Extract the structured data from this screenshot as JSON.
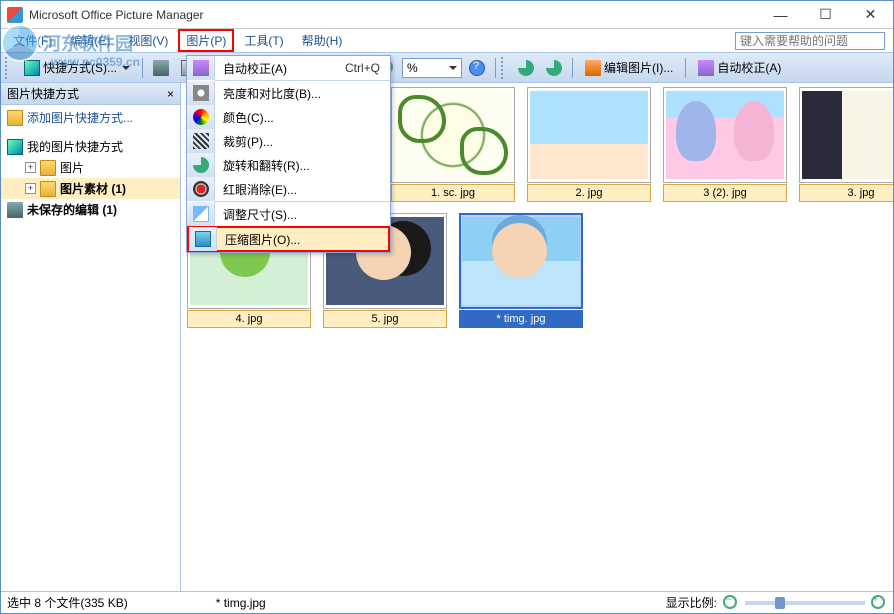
{
  "app": {
    "title": "Microsoft Office Picture Manager"
  },
  "window_controls": {
    "min": "—",
    "max": "☐",
    "close": "✕"
  },
  "menubar": {
    "items": [
      {
        "label": "文件(F)"
      },
      {
        "label": "编辑(E)"
      },
      {
        "label": "视图(V)"
      },
      {
        "label": "图片(P)",
        "active": true
      },
      {
        "label": "工具(T)"
      },
      {
        "label": "帮助(H)"
      }
    ],
    "help_placeholder": "键入需要帮助的问题"
  },
  "toolbar1": {
    "shortcut_label": "快捷方式(S)...",
    "zoom_value": "%"
  },
  "toolbar2": {
    "edit_btn": "编辑图片(I)...",
    "auto_btn": "自动校正(A)"
  },
  "dropdown": {
    "items": [
      {
        "label": "自动校正(A)",
        "accel": "Ctrl+Q",
        "icon": "auto"
      },
      {
        "label": "亮度和对比度(B)...",
        "icon": "bc"
      },
      {
        "label": "颜色(C)...",
        "icon": "color"
      },
      {
        "label": "裁剪(P)...",
        "icon": "crop"
      },
      {
        "label": "旋转和翻转(R)...",
        "icon": "rotate"
      },
      {
        "label": "红眼消除(E)...",
        "icon": "redeye"
      },
      {
        "label": "调整尺寸(S)...",
        "icon": "resize"
      },
      {
        "label": "压缩图片(O)...",
        "icon": "compress",
        "highlight": true
      }
    ]
  },
  "sidebar": {
    "header": "图片快捷方式",
    "add_link": "添加图片快捷方式...",
    "root": "我的图片快捷方式",
    "items": [
      {
        "label": "图片"
      },
      {
        "label": "图片素材 (1)",
        "selected": true
      }
    ],
    "unsaved": "未保存的编辑 (1)"
  },
  "thumbs": [
    {
      "caption": "1. sc. jpg",
      "img": "img1"
    },
    {
      "caption": "2. jpg",
      "img": "img2"
    },
    {
      "caption": "3 (2). jpg",
      "img": "img3"
    },
    {
      "caption": "3. jpg",
      "img": "img4"
    },
    {
      "caption": "4. jpg",
      "img": "img5"
    },
    {
      "caption": "5. jpg",
      "img": "img6"
    },
    {
      "caption": "* timg. jpg",
      "img": "img7",
      "selected": true
    }
  ],
  "status": {
    "left": "选中 8 个文件(335 KB)",
    "mid": "* timg.jpg",
    "zoom_label": "显示比例:"
  },
  "watermark": {
    "name": "河东软件园",
    "url": "www.pc0359.cn"
  }
}
